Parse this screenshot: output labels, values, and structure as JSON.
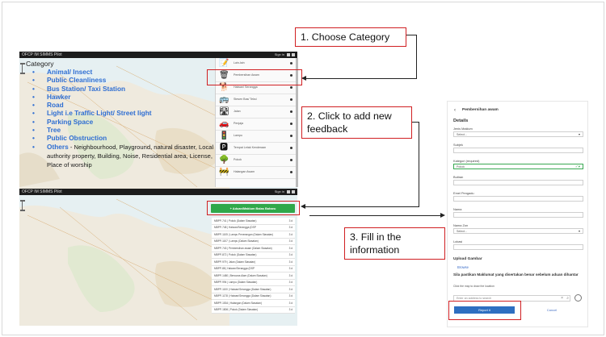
{
  "callouts": {
    "step1": "1. Choose Category",
    "step2_line1": "2. Click to add new",
    "step2_line2": "feedback",
    "step3_line1": "3. Fill in the",
    "step3_line2": "information"
  },
  "app": {
    "title": "OFCP IM SIMMS Pilot",
    "sign_in": "Sign in"
  },
  "category": {
    "title": "Category",
    "items": [
      {
        "label": "Animal/ Insect"
      },
      {
        "label": "Public Cleanliness"
      },
      {
        "label": "Bus Station/ Taxi Station"
      },
      {
        "label": "Hawker"
      },
      {
        "label": "Road"
      },
      {
        "label": "Light i.e Traffic Light/ Street light"
      },
      {
        "label": "Parking Space"
      },
      {
        "label": "Tree"
      },
      {
        "label": "Public Obstruction"
      },
      {
        "label": "Others",
        "note": " - Neighbourhood, Playground, natural disaster, Local authority  property, Building, Noise, Residential area, License, Place of worship"
      }
    ]
  },
  "panel": {
    "rows": [
      {
        "icon": "📝",
        "text": "Lain-lain"
      },
      {
        "icon": "🗑",
        "text": "Pembersihan Awam"
      },
      {
        "icon": "🐕",
        "text": "Haiwan/ Serangga"
      },
      {
        "icon": "🚌",
        "text": "Stesen Bas/ Teksi"
      },
      {
        "icon": "🛣",
        "text": "Jalan"
      },
      {
        "icon": "🚗",
        "text": "Penjaja"
      },
      {
        "icon": "🚦",
        "text": "Lampu"
      },
      {
        "icon": "🅿",
        "text": "Tempat Letak Kenderaan"
      },
      {
        "icon": "🌳",
        "text": "Pokok"
      },
      {
        "icon": "🚧",
        "text": "Halangan Awam"
      }
    ]
  },
  "feedback": {
    "add_button": "+ Aduan/Maklum Balas Baharu",
    "rows": [
      {
        "text": "MBPP-741 | Pokok (Dalam Siasatan)",
        "n": "3 d"
      },
      {
        "text": "MBPP-748 | Haiwan/Serangga (DSP",
        "n": "3 d"
      },
      {
        "text": "MBPP-1105 | Lampu Penerangan (Dalam Siasatan)",
        "n": "3 d"
      },
      {
        "text": "MBPP-1107 | Lampu (Dalam Siasatan)",
        "n": "3 d"
      },
      {
        "text": "MBPP-743 | Pembersihan awam (Dalam Siasatan)",
        "n": "3 d"
      },
      {
        "text": "MBPP-872 | Pokok (Dalam Siasatan)",
        "n": "3 d"
      },
      {
        "text": "MBPP-979 | Jalan (Dalam Siasatan)",
        "n": "3 d"
      },
      {
        "text": "MBPP-88 | Haiwan/Serangga (DSP",
        "n": "3 d"
      },
      {
        "text": "MBPP-1480 | Bencana Alam (Dalam Siasatan)",
        "n": "3 d"
      },
      {
        "text": "MBPP-994 | Lampu (Dalam Siasatan)",
        "n": "3 d"
      },
      {
        "text": "MBPP-1100 | Haiwan/Serangga (Dalam Siasatan)",
        "n": "3 d"
      },
      {
        "text": "MBPP-1178 | Haiwan/Serangga (Dalam Siasatan)",
        "n": "3 d"
      },
      {
        "text": "MBPP-1534 | Halangan (Dalam Siasatan)",
        "n": "3 d"
      },
      {
        "text": "MBPP-1806 | Pokok (Dalam Siasatan)",
        "n": "3 d"
      }
    ]
  },
  "form": {
    "back": "‹",
    "header": "Pembersihan awam",
    "details": "Details",
    "jenis_label": "Jenis Maklum",
    "jenis_value": "Select...",
    "subjek_label": "Subjek",
    "kategori_label": "Kategori (required)",
    "kategori_value": "Pokok",
    "butiran_label": "Butiran",
    "emel_label": "Emel Pengadu",
    "nama_label": "Nama",
    "nama_zon_label": "Nama Zon",
    "nama_zon_value": "Select...",
    "lokasi_label": "Lokasi",
    "upload": "Upload Gambar",
    "browse": "Browse",
    "confirm": "Sila pastikan Maklumat yang disertakan benar sebelum aduan dihantar",
    "map_hint": "Click the map to draw the location",
    "search_placeholder": "Enter an address to search",
    "report": "Report it",
    "cancel": "Cancel"
  },
  "colors": {
    "accent_red": "#d01f22",
    "category_blue": "#2f6ed2",
    "button_green": "#2fa84a",
    "report_blue": "#2e6fc1"
  }
}
